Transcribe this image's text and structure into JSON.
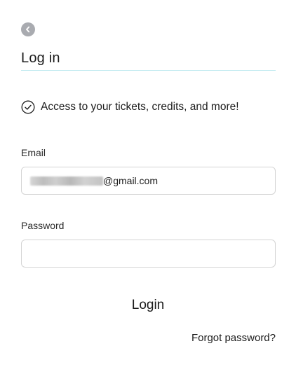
{
  "header": {
    "back_icon": "chevron-left-icon",
    "title": "Log in",
    "underline_color": "#bfeaf0"
  },
  "notice": {
    "icon": "check-circle-icon",
    "text": "Access to your tickets, credits, and more!"
  },
  "form": {
    "email": {
      "label": "Email",
      "value": "@gmail.com",
      "redacted_prefix": true
    },
    "password": {
      "label": "Password",
      "value": ""
    },
    "submit_label": "Login",
    "forgot_label": "Forgot password?"
  },
  "colors": {
    "back_button_bg": "#a9abb0",
    "field_border": "#d4d4d4",
    "text": "#1c1c1c"
  }
}
